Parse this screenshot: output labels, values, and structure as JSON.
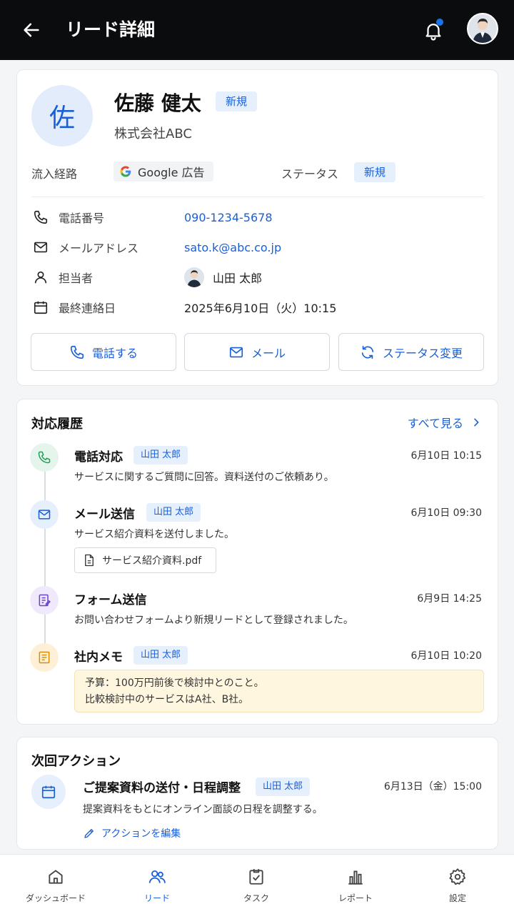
{
  "header": {
    "title": "リード詳細",
    "has_notification": true
  },
  "profile": {
    "avatar_char": "佐",
    "name": "佐藤 健太",
    "name_badge": "新規",
    "company": "株式会社ABC",
    "source_label": "流入経路",
    "source_value": "Google 広告",
    "status_label": "ステータス",
    "status_value": "新規",
    "info": [
      {
        "icon": "phone-icon",
        "label": "電話番号",
        "value": "090-1234-5678"
      },
      {
        "icon": "mail-icon",
        "label": "メールアドレス",
        "value": "sato.k@abc.co.jp"
      },
      {
        "icon": "person-icon",
        "label": "担当者",
        "value": "山田 太郎"
      },
      {
        "icon": "calendar-icon",
        "label": "最終連絡日",
        "value": "2025年6月10日（火）10:15"
      }
    ],
    "actions": {
      "call": "電話する",
      "mail": "メール",
      "status": "ステータス変更"
    }
  },
  "history": {
    "title": "対応履歴",
    "see_all": "すべて見る",
    "items": [
      {
        "title": "電話対応",
        "owner": "山田 太郎",
        "time": "6月10日 10:15",
        "desc": "サービスに関するご質問に回答。資料送付のご依頼あり。"
      },
      {
        "title": "メール送信",
        "owner": "山田 太郎",
        "time": "6月10日 09:30",
        "desc": "サービス紹介資料を送付しました。",
        "attachment": "サービス紹介資料.pdf"
      },
      {
        "title": "フォーム送信",
        "owner": "",
        "time": "6月9日 14:25",
        "desc": "お問い合わせフォームより新規リードとして登録されました。"
      },
      {
        "title": "社内メモ",
        "owner": "山田 太郎",
        "time": "6月10日 10:20",
        "memo_line1": "予算：100万円前後で検討中とのこと。",
        "memo_line2": "比較検討中のサービスはA社、B社。"
      }
    ]
  },
  "next_action": {
    "title": "次回アクション",
    "task": "ご提案資料の送付・日程調整",
    "owner": "山田 太郎",
    "time": "6月13日（金）15:00",
    "desc": "提案資料をもとにオンライン面談の日程を調整する。",
    "edit": "アクションを編集"
  },
  "nav": {
    "items": [
      {
        "label": "ダッシュボード",
        "icon": "home-icon"
      },
      {
        "label": "リード",
        "icon": "people-icon",
        "active": true
      },
      {
        "label": "タスク",
        "icon": "task-icon"
      },
      {
        "label": "レポート",
        "icon": "chart-icon"
      },
      {
        "label": "設定",
        "icon": "gear-icon"
      }
    ]
  },
  "colors": {
    "accent": "#1a5fd6",
    "header_bg": "#0b0c0e",
    "memo_bg": "#fff6e0"
  }
}
